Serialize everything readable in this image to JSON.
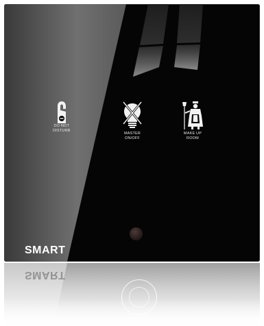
{
  "brand": {
    "label": "SMART"
  },
  "reflection": {
    "label": "SMART"
  },
  "buttons": [
    {
      "id": "dnd",
      "label": "DO NOT\nDISTURB",
      "icon": "door-hanger-icon"
    },
    {
      "id": "master",
      "label": "MASTER\nON/OFF",
      "icon": "crossed-bulb-icon"
    },
    {
      "id": "mur",
      "label": "MAKE UP\nROOM",
      "icon": "housekeeper-icon"
    }
  ],
  "colors": {
    "panel": "#050505",
    "gloss": "#6b6b6b",
    "icon": "#f2f2f2",
    "sensor": "#2b1f1e"
  }
}
